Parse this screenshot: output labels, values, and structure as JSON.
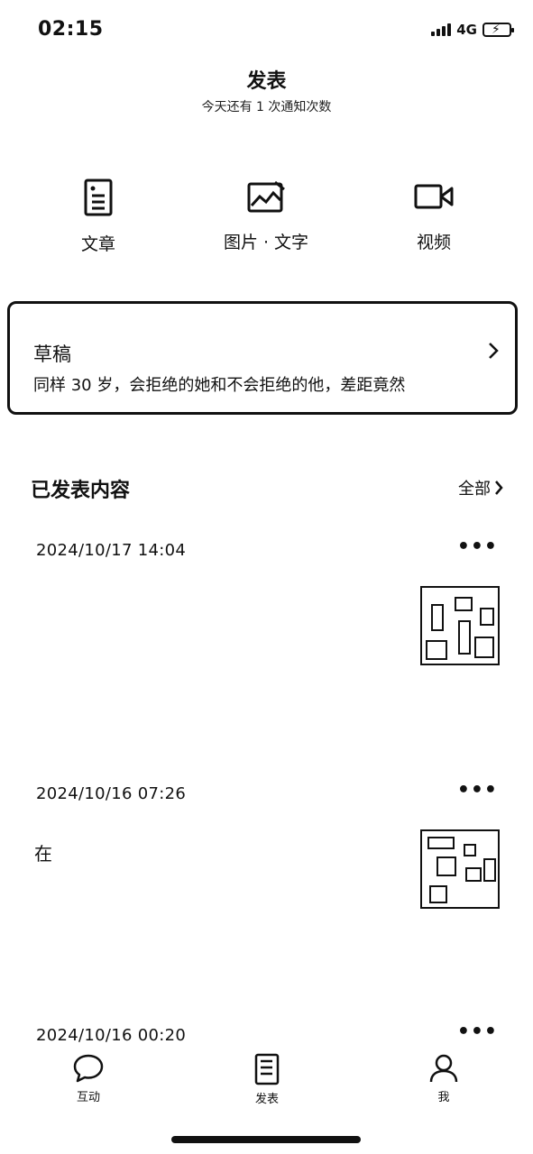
{
  "status": {
    "time": "02:15",
    "network": "4G"
  },
  "header": {
    "title": "发表",
    "subtitle": "今天还有 1 次通知次数"
  },
  "publish_types": [
    {
      "label": "文章",
      "icon": "document-icon"
    },
    {
      "label": "图片 · 文字",
      "icon": "image-icon"
    },
    {
      "label": "视频",
      "icon": "video-icon"
    }
  ],
  "draft": {
    "title": "草稿",
    "text": "同样 30 岁，会拒绝的她和不会拒绝的他，差距竟然"
  },
  "published": {
    "title": "已发表内容",
    "all_label": "全部",
    "posts": [
      {
        "date": "2024/10/17 14:04",
        "text": "",
        "meta": ""
      },
      {
        "date": "2024/10/16 07:26",
        "text": "在",
        "meta": ""
      },
      {
        "date": "2024/10/16 00:20",
        "text": "",
        "meta": ""
      }
    ]
  },
  "tabbar": {
    "tabs": [
      {
        "label": "互动"
      },
      {
        "label": "发表"
      },
      {
        "label": "我"
      }
    ]
  }
}
